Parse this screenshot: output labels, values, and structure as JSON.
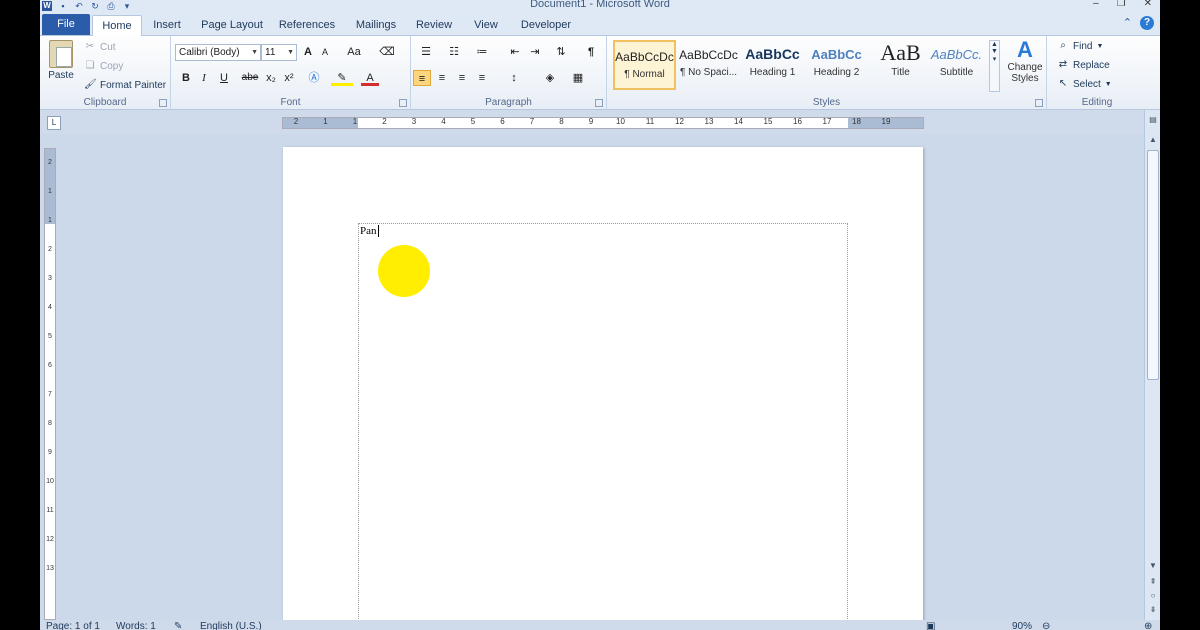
{
  "window": {
    "title": "Document1  -  Microsoft Word",
    "logo": "W"
  },
  "tabs": {
    "file": "File",
    "items": [
      "Home",
      "Insert",
      "Page Layout",
      "References",
      "Mailings",
      "Review",
      "View",
      "Developer"
    ],
    "active": "Home"
  },
  "clipboard": {
    "paste": "Paste",
    "cut": "Cut",
    "copy": "Copy",
    "format_painter": "Format Painter",
    "label": "Clipboard"
  },
  "font": {
    "name": "Calibri (Body)",
    "size": "11",
    "grow": "A",
    "shrink": "A",
    "change_case": "Aa",
    "bold": "B",
    "italic": "I",
    "underline": "U",
    "strike": "abe",
    "subscript": "x₂",
    "superscript": "x²",
    "font_color": "A",
    "label": "Font"
  },
  "paragraph": {
    "pilcrow": "¶",
    "label": "Paragraph"
  },
  "styles": {
    "items": [
      {
        "sample": "AaBbCcDc",
        "name": "¶ Normal"
      },
      {
        "sample": "AaBbCcDc",
        "name": "¶ No Spaci..."
      },
      {
        "sample": "AaBbCc",
        "name": "Heading 1"
      },
      {
        "sample": "AaBbCc",
        "name": "Heading 2"
      },
      {
        "sample": "AaB",
        "name": "Title"
      },
      {
        "sample": "AaBbCc.",
        "name": "Subtitle"
      }
    ],
    "change_styles_line1": "Change",
    "change_styles_line2": "Styles",
    "label": "Styles"
  },
  "editing": {
    "find": "Find",
    "replace": "Replace",
    "select": "Select",
    "label": "Editing"
  },
  "ruler": {
    "h_numbers": [
      "2",
      "1",
      "1",
      "2",
      "3",
      "4",
      "5",
      "6",
      "7",
      "8",
      "9",
      "10",
      "11",
      "12",
      "13",
      "14",
      "15",
      "16",
      "17",
      "18",
      "19"
    ],
    "v_numbers": [
      "2",
      "1",
      "1",
      "2",
      "3",
      "4",
      "5",
      "6",
      "7",
      "8",
      "9",
      "10",
      "11",
      "12",
      "13"
    ]
  },
  "document": {
    "text": "Pan",
    "shape_color": "#ffee00"
  },
  "status": {
    "page": "Page: 1 of 1",
    "words": "Words: 1",
    "language": "English (U.S.)",
    "zoom": "90%"
  }
}
